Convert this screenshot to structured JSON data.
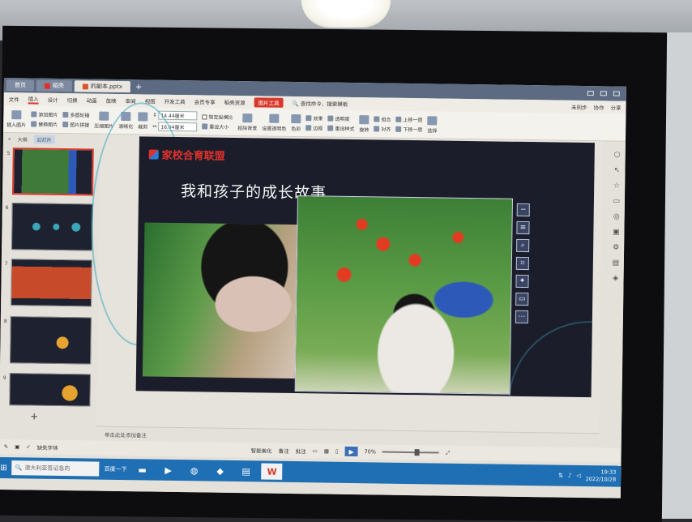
{
  "titlebar": {
    "tabs": [
      {
        "label": "首页"
      },
      {
        "label": "稻壳"
      },
      {
        "label": "的副本.pptx"
      }
    ]
  },
  "menu": {
    "items": [
      "文件",
      "插入",
      "设计",
      "切换",
      "动画",
      "放映",
      "审阅",
      "视图",
      "开发工具",
      "会员专享",
      "稻壳资源"
    ],
    "picture_tools": "图片工具",
    "search": "查找命令、搜索模板",
    "right": [
      "未同步",
      "协作",
      "分享"
    ]
  },
  "ribbon": {
    "insert_picture": "插入图片",
    "add_picture": "添加图片",
    "multi_crop": "多图轮播",
    "change_picture": "替换图片",
    "picture_stitch": "图片拼接",
    "compress": "压缩图片",
    "clarify": "清晰化",
    "crop": "裁剪",
    "height_value": "14.44厘米",
    "width_value": "16.04厘米",
    "lock_ratio": "锁定纵横比",
    "reset_size": "重设大小",
    "remove_bg": "抠除背景",
    "set_transparent": "设置透明色",
    "color": "色彩",
    "effects": "效果",
    "transparency": "透明度",
    "border": "边框",
    "reset_style": "重设样式",
    "rotate": "旋转",
    "group": "组合",
    "align": "对齐",
    "bring_forward": "上移一层",
    "send_backward": "下移一层",
    "select": "选择"
  },
  "panel": {
    "tab_outline": "大纲",
    "tab_slides": "幻灯片",
    "slide_numbers": [
      "5",
      "6",
      "7",
      "8",
      "9"
    ]
  },
  "slide": {
    "logo_text": "家校合育联盟",
    "title": "我和孩子的成长故事"
  },
  "notes_placeholder": "单击此处添加备注",
  "status": {
    "missing_font": "缺失字体",
    "smart_beautify": "智能美化",
    "notes": "备注",
    "comments": "批注",
    "zoom": "70%"
  },
  "taskbar": {
    "search_placeholder": "澳大利亚签证急的",
    "baidu": "百度一下",
    "time": "19:33",
    "date": "2022/10/28"
  }
}
